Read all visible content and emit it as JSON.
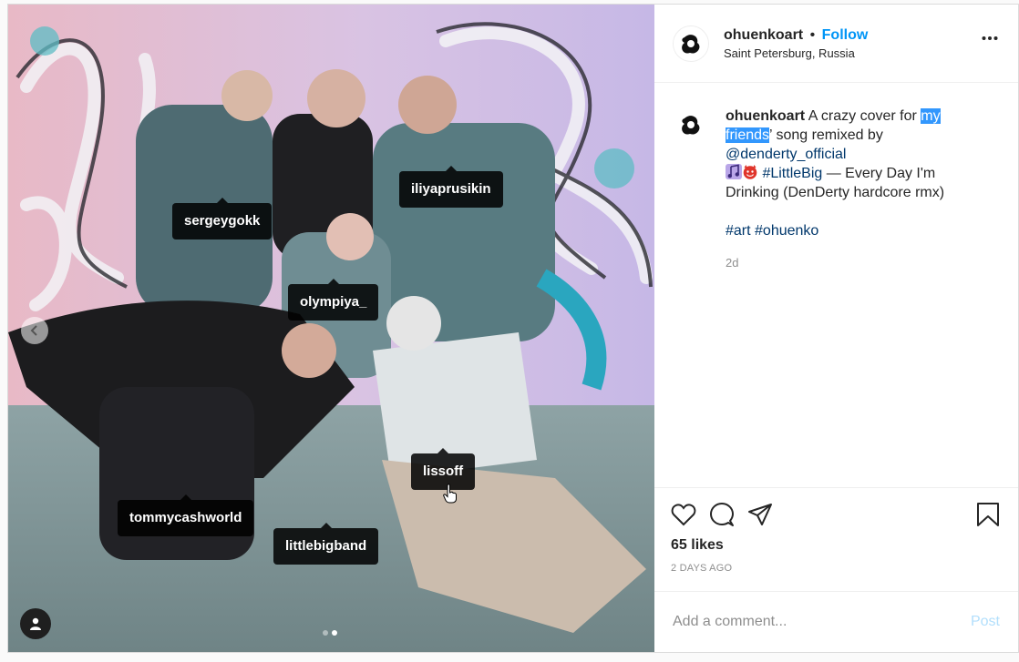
{
  "post": {
    "username": "ohuenkoart",
    "separator": "•",
    "follow_label": "Follow",
    "location": "Saint Petersburg, Russia",
    "caption": {
      "username": "ohuenkoart",
      "text_1": "A crazy cover for",
      "highlighted": "my friends",
      "text_2": "’ song remixed by",
      "mention": "@denderty_official",
      "hashtag_song": "#LittleBig",
      "text_3": "— Every Day I'm Drinking (DenDerty hardcore rmx)",
      "hashtags": [
        "#art",
        "#ohuenko"
      ],
      "time_ago": "2d"
    },
    "likes": "65 likes",
    "date": "2 DAYS AGO",
    "comment": {
      "placeholder": "Add a comment...",
      "post_label": "Post"
    }
  },
  "photo": {
    "tags": [
      "sergeygokk",
      "iliyaprusikin",
      "olympiya_",
      "lissoff",
      "tommycashworld",
      "littlebigband"
    ],
    "carousel": {
      "count": 2,
      "active_index": 1
    }
  }
}
